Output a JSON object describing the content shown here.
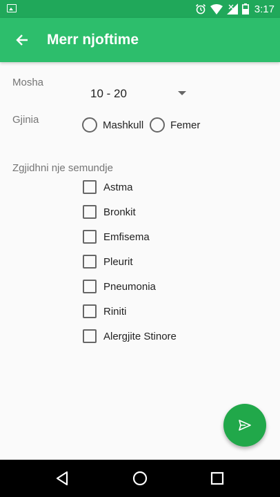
{
  "status_bar": {
    "time": "3:17",
    "icons": [
      "image-icon",
      "alarm-icon",
      "wifi-icon",
      "signal-icon",
      "battery-icon"
    ]
  },
  "app_bar": {
    "title": "Merr njoftime",
    "back_icon": "arrow-back-icon",
    "color": "#2dbe6c",
    "status_color": "#20a85a"
  },
  "form": {
    "age": {
      "label": "Mosha",
      "selected": "10 - 20"
    },
    "gender": {
      "label": "Gjinia",
      "options": [
        {
          "label": "Mashkull",
          "checked": false
        },
        {
          "label": "Femer",
          "checked": false
        }
      ]
    },
    "diseases": {
      "label": "Zgjidhni nje semundje",
      "items": [
        {
          "label": "Astma",
          "checked": false
        },
        {
          "label": "Bronkit",
          "checked": false
        },
        {
          "label": "Emfisema",
          "checked": false
        },
        {
          "label": "Pleurit",
          "checked": false
        },
        {
          "label": "Pneumonia",
          "checked": false
        },
        {
          "label": "Riniti",
          "checked": false
        },
        {
          "label": "Alergjite Stinore",
          "checked": false
        }
      ]
    }
  },
  "fab": {
    "icon": "send-icon",
    "color": "#21a84a"
  },
  "nav_bar": {
    "icons": [
      "back-triangle-icon",
      "home-circle-icon",
      "recents-square-icon"
    ]
  }
}
